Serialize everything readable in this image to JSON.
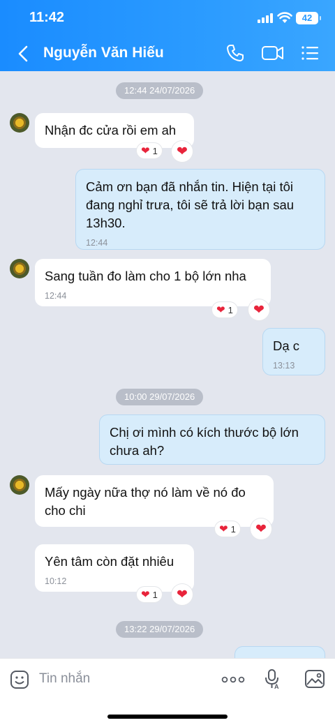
{
  "status": {
    "time": "11:42",
    "battery": "42"
  },
  "header": {
    "contact_name": "Nguyễn Văn Hiếu"
  },
  "messages": [
    {
      "type": "date",
      "text": "12:44 24/07/2026"
    },
    {
      "type": "in",
      "text": "Nhận đc cửa rồi em ah",
      "reaction_count": "1"
    },
    {
      "type": "out",
      "text": "Cảm ơn bạn đã nhắn tin. Hiện tại tôi đang nghỉ trưa, tôi sẽ trả lời bạn sau 13h30.",
      "time": "12:44"
    },
    {
      "type": "in",
      "text": "Sang tuần đo làm cho 1 bộ lớn nha",
      "time": "12:44",
      "reaction_count": "1"
    },
    {
      "type": "out",
      "text": "Dạ c",
      "time": "13:13"
    },
    {
      "type": "date",
      "text": "10:00 29/07/2026"
    },
    {
      "type": "out",
      "text": "Chị ơi mình có kích thước bộ lớn chưa ah?"
    },
    {
      "type": "in",
      "text": "Mấy ngày nữa thợ nó làm về nó đo cho chi",
      "reaction_count": "1"
    },
    {
      "type": "in",
      "text": "Yên tâm còn đặt nhiêu",
      "time": "10:12",
      "reaction_count": "1"
    },
    {
      "type": "date",
      "text": "13:22 29/07/2026"
    }
  ],
  "composer": {
    "placeholder": "Tin nhắn"
  }
}
